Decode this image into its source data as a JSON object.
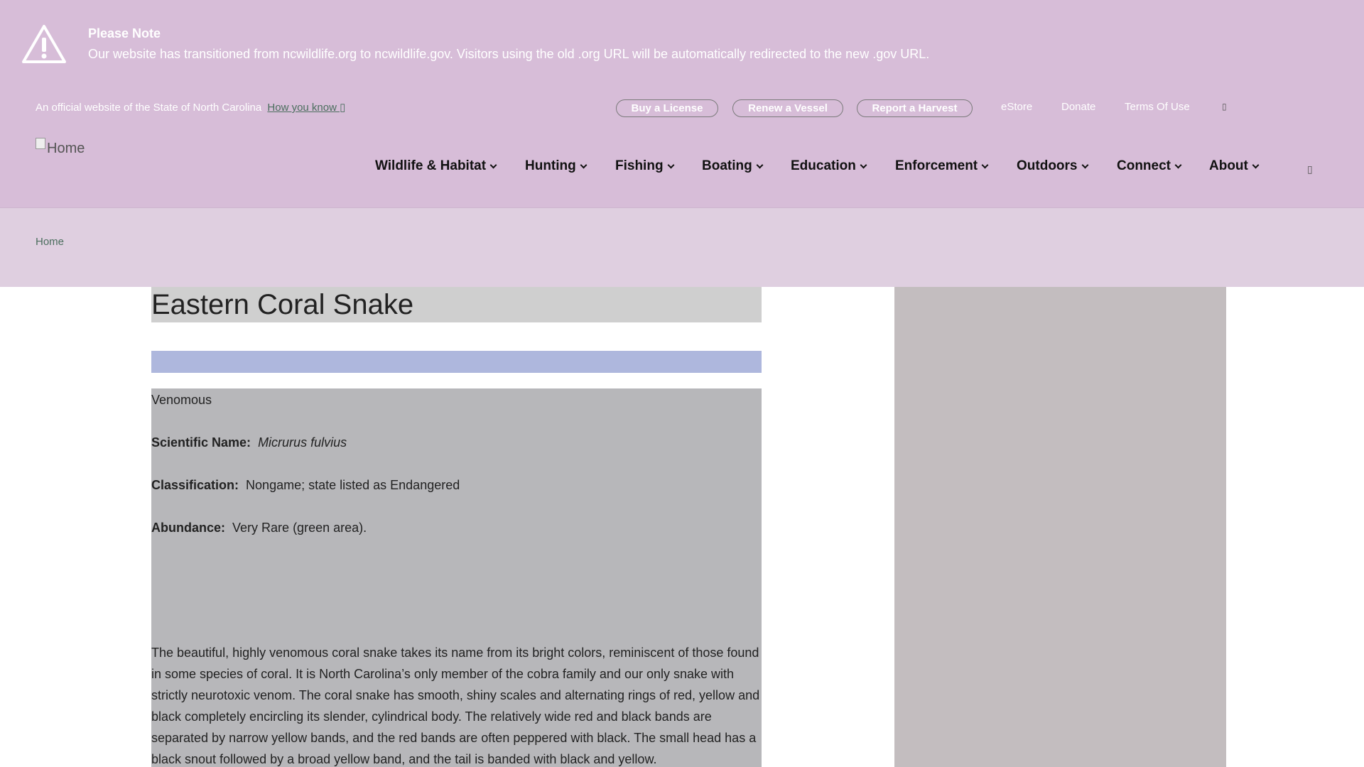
{
  "alert": {
    "title": "Please Note",
    "message": "Our website has transitioned from ncwildlife.org to ncwildlife.gov. Visitors using the old .org URL will be automatically redirected to the new .gov URL.",
    "icon": "warning-triangle-icon"
  },
  "banner": {
    "official_text": "An official website of the State of North Carolina",
    "how_you_know": "How you know ▯"
  },
  "utility": {
    "buttons": [
      "Buy a License",
      "Renew a Vessel",
      "Report a Harvest"
    ],
    "links": [
      "eStore",
      "Donate",
      "Terms Of Use"
    ],
    "extra_icon": "▯"
  },
  "logo": {
    "alt": "Home"
  },
  "nav": {
    "items": [
      "Wildlife & Habitat",
      "Hunting",
      "Fishing",
      "Boating",
      "Education",
      "Enforcement",
      "Outdoors",
      "Connect",
      "About"
    ],
    "search_icon": "▯"
  },
  "breadcrumb": {
    "home": "Home"
  },
  "page": {
    "title": "Eastern Coral Snake",
    "venom": "Venomous",
    "scientific_label": "Scientific Name:",
    "scientific_value": "Micrurus fulvius",
    "classification_label": "Classification:",
    "classification_value": "Nongame; state listed as Endangered",
    "abundance_label": "Abundance:",
    "abundance_value": "Very Rare (green area).",
    "description": "The beautiful, highly venomous coral snake takes its name from its bright colors, reminiscent of those found in some species of coral. It is North Carolina’s only member of the cobra family and our only snake with strictly neurotoxic venom. The coral snake has smooth, shiny scales and alternating rings of red, yellow and black completely encircling its slender, cylindrical body. The relatively wide red and black bands are separated by narrow yellow bands, and the red bands are often peppered with black. The small head has a black snout followed by a broad yellow band, and the tail is banded with black and yellow."
  },
  "colors": {
    "header_bg": "#d7bdd8",
    "breadcrumb_bg": "#dfcfe0",
    "link_green": "#4b6e5e"
  }
}
